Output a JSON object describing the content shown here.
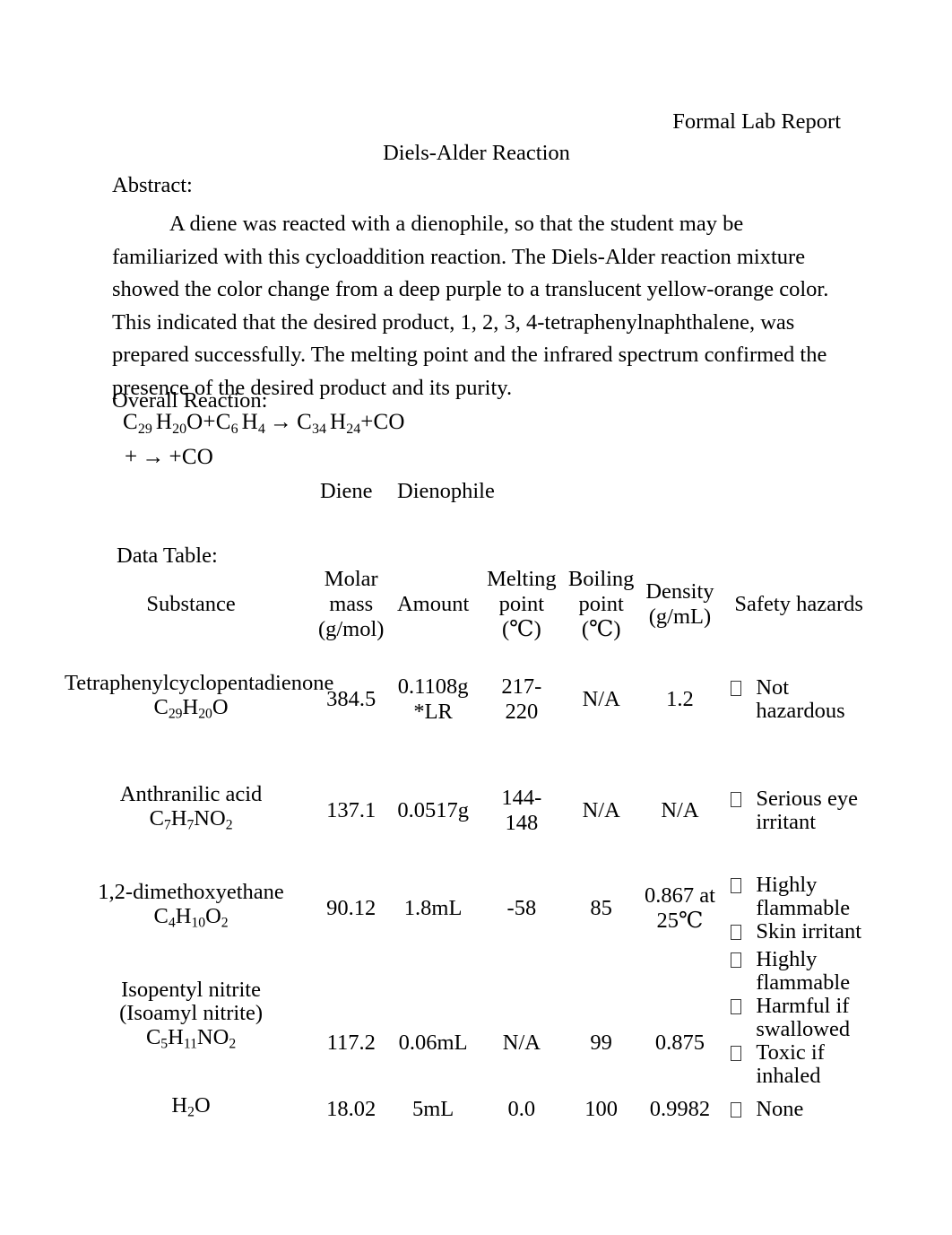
{
  "document": {
    "header_right": "Formal Lab Report",
    "title": "Diels-Alder Reaction",
    "abstract_label": "Abstract:",
    "abstract_body": "A diene was reacted with a dienophile, so that the student may be familiarized with this cycloaddition reaction. The Diels-Alder reaction mixture showed the color change from a deep purple to a translucent yellow-orange color. This indicated that the desired product, 1, 2, 3, 4-tetraphenylnaphthalene, was prepared successfully. The melting point and the infrared spectrum confirmed the presence of the desired product and its purity.",
    "overall_reaction_label": "Overall Reaction:",
    "data_table_label": "Data Table:"
  },
  "equation": {
    "line1": {
      "reactant1": {
        "element1": "C",
        "sub1": "29",
        "element2": "H",
        "sub2": "20",
        "element3": "O"
      },
      "plus1": "+",
      "reactant2": {
        "element1": "C",
        "sub1": "6",
        "element2": "H",
        "sub2": "4"
      },
      "arrow": "→",
      "product1": {
        "element1": "C",
        "sub1": "34",
        "element2": "H",
        "sub2": "24"
      },
      "plus2": "+",
      "product2": "CO"
    },
    "line2": {
      "plus1": "+",
      "arrow": "→",
      "plus2": "+",
      "product": "CO"
    }
  },
  "reaction_labels": {
    "diene": "Diene",
    "dienophile": "Dienophile"
  },
  "table": {
    "headers": {
      "substance": "Substance",
      "molar_mass_l1": "Molar",
      "molar_mass_l2": "mass",
      "molar_mass_l3": "(g/mol)",
      "amount": "Amount",
      "melting_l1": "Melting",
      "melting_l2": "point",
      "melting_l3": "(℃)",
      "boiling_l1": "Boiling",
      "boiling_l2": "point",
      "boiling_l3": "(℃)",
      "density_l1": "Density",
      "density_l2": "(g/mL)",
      "safety": "Safety hazards"
    },
    "rows": [
      {
        "name": "Tetraphenylcyclopentadienone",
        "formula": {
          "parts": [
            [
              "C",
              "29"
            ],
            [
              "H",
              "20"
            ],
            [
              "O",
              ""
            ]
          ]
        },
        "molar_mass": "384.5",
        "amount_l1": "0.1108g",
        "amount_l2": "*LR",
        "melting_l1": "217-",
        "melting_l2": "220",
        "boiling": "N/A",
        "density": "1.2",
        "hazards": [
          "Not hazardous"
        ]
      },
      {
        "name": "Anthranilic acid",
        "formula": {
          "parts": [
            [
              "C",
              "7"
            ],
            [
              "H",
              "7"
            ],
            [
              "NO",
              "2"
            ]
          ]
        },
        "molar_mass": "137.1",
        "amount_l1": "0.0517g",
        "amount_l2": "",
        "melting_l1": "144-",
        "melting_l2": "148",
        "boiling": "N/A",
        "density": "N/A",
        "hazards": [
          "Serious eye irritant"
        ]
      },
      {
        "name": "1,2-dimethoxyethane",
        "formula": {
          "parts": [
            [
              "C",
              "4"
            ],
            [
              "H",
              "10"
            ],
            [
              "O",
              "2"
            ]
          ]
        },
        "molar_mass": "90.12",
        "amount_l1": "1.8mL",
        "amount_l2": "",
        "melting_l1": "-58",
        "melting_l2": "",
        "boiling": "85",
        "density_l1": "0.867 at",
        "density_l2": "25℃",
        "hazards": [
          "Highly flammable",
          "Skin irritant"
        ]
      },
      {
        "name": "Isopentyl nitrite",
        "name2": "(Isoamyl nitrite)",
        "formula": {
          "parts": [
            [
              "C",
              "5"
            ],
            [
              "H",
              "11"
            ],
            [
              "NO",
              "2"
            ]
          ]
        },
        "molar_mass": "117.2",
        "amount_l1": "0.06mL",
        "amount_l2": "",
        "melting_l1": "N/A",
        "melting_l2": "",
        "boiling": "99",
        "density": "0.875",
        "hazards": [
          "Highly flammable",
          "Harmful if swallowed",
          "Toxic if inhaled"
        ]
      },
      {
        "name": "",
        "formula": {
          "parts": [
            [
              "H",
              "2"
            ],
            [
              "O",
              ""
            ]
          ]
        },
        "molar_mass": "18.02",
        "amount_l1": "5mL",
        "amount_l2": "",
        "melting_l1": "0.0",
        "melting_l2": "",
        "boiling": "100",
        "density": "0.9982",
        "hazards": [
          "None"
        ]
      }
    ]
  }
}
